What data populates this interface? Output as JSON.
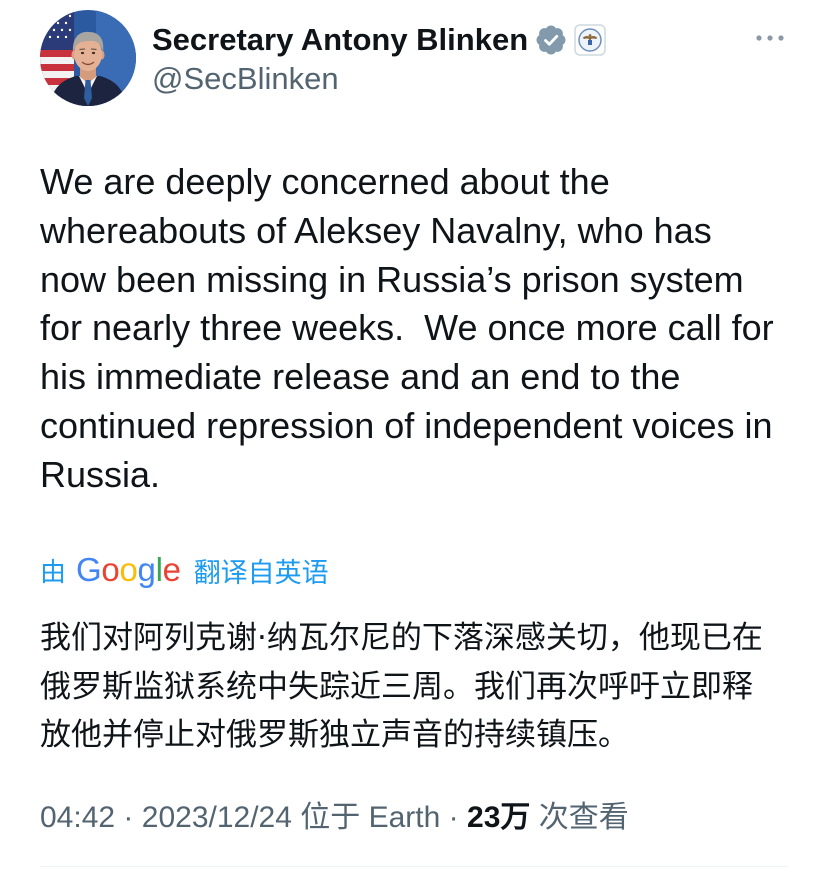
{
  "author": {
    "name": "Secretary Antony Blinken",
    "handle": "@SecBlinken",
    "avatar_icon": "profile-photo-avatar",
    "verified_icon": "verified-badge-icon",
    "affiliation_icon": "us-department-of-state-seal-icon"
  },
  "actions": {
    "more_icon": "more-options-icon"
  },
  "tweet": {
    "text_lines": [
      "We are deeply concerned about the",
      "whereabouts of Aleksey Navalny, who has",
      "now been missing in Russia’s prison system",
      "for nearly three weeks.  We once more call for",
      "his immediate release and an end to the",
      "continued repression of independent voices in",
      "Russia."
    ]
  },
  "translation": {
    "by": "由",
    "provider": "Google",
    "source_label": "翻译自英语",
    "text_lines": [
      "我们对阿列克谢·纳瓦尔尼的下落深感关切，他现已在",
      "俄罗斯监狱系统中失踪近三周。我们再次呼吁立即释",
      "放他并停止对俄罗斯独立声音的持续镇压。"
    ]
  },
  "meta": {
    "time": "04:42",
    "separator": "·",
    "date": "2023/12/24",
    "location_prefix": "位于",
    "location": "Earth",
    "views_count": "23万",
    "views_label": "次查看"
  },
  "colors": {
    "text_primary": "#0f1419",
    "text_secondary": "#536471",
    "translation_link": "#1d9bf0",
    "verified_badge": "#829aab",
    "divider": "#eff3f4",
    "google_letters": [
      "#4285f4",
      "#ea4335",
      "#fbbc05",
      "#4285f4",
      "#34a853",
      "#ea4335"
    ]
  }
}
